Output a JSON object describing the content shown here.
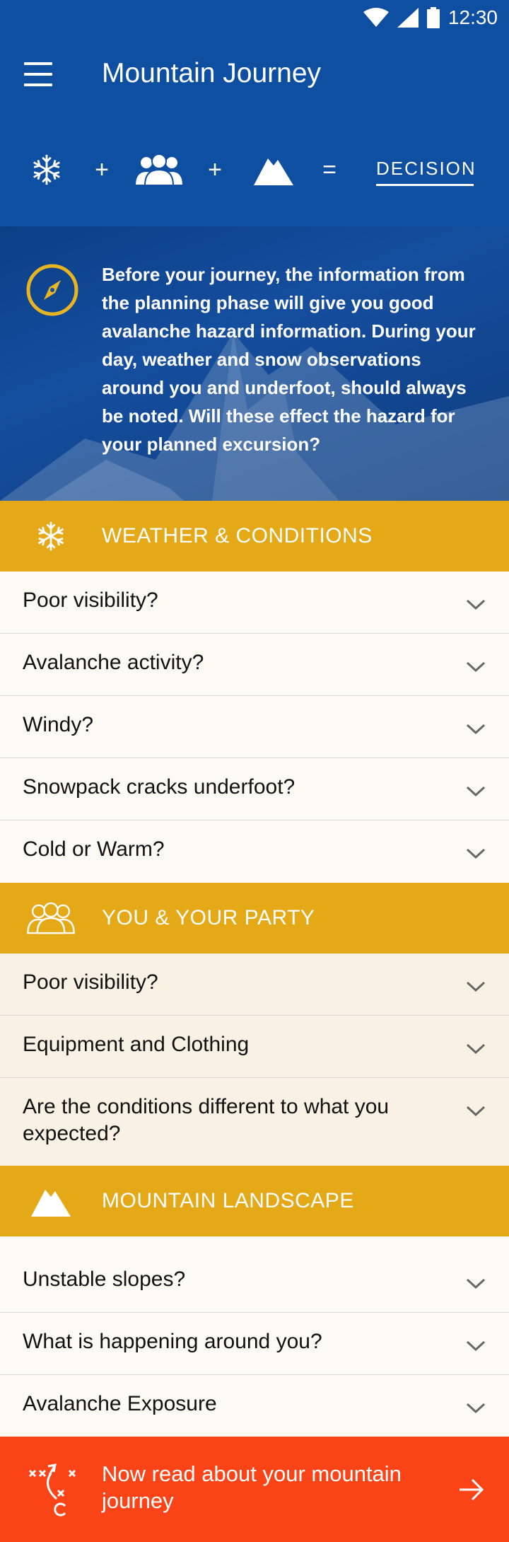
{
  "status_bar": {
    "time": "12:30"
  },
  "app_bar": {
    "title": "Mountain Journey",
    "menu_icon": "hamburger-menu-icon"
  },
  "equation": {
    "items": [
      "snowflake-icon",
      "+",
      "people-icon",
      "+",
      "mountain-icon",
      "="
    ],
    "decision_label": "DECISION"
  },
  "intro": {
    "icon": "compass-icon",
    "text": "Before your journey, the information from the planning phase will give you good avalanche hazard information. During your day, weather and snow observations around you and underfoot, should always be noted. Will these effect the hazard for your planned excursion?"
  },
  "sections": [
    {
      "title": "WEATHER & CONDITIONS",
      "icon": "snowflake-icon",
      "items": [
        "Poor visibility?",
        "Avalanche activity?",
        "Windy?",
        "Snowpack cracks underfoot?",
        "Cold or Warm?"
      ]
    },
    {
      "title": "YOU & YOUR PARTY",
      "icon": "people-icon",
      "items": [
        "Poor visibility?",
        "Equipment and Clothing",
        "Are the conditions different to what you expected?"
      ]
    },
    {
      "title": "MOUNTAIN LANDSCAPE",
      "icon": "mountain-icon",
      "items": [
        "Unstable slopes?",
        "What is happening around you?",
        "Avalanche Exposure"
      ]
    }
  ],
  "cta": {
    "label": "Now read about your mountain journey",
    "icon": "strategy-play-icon",
    "arrow_icon": "arrow-right-icon"
  },
  "colors": {
    "primary_blue": "#0f4fa1",
    "section_gold": "#e5a917",
    "cta_orange": "#fa4316",
    "row_bg": "#fdfaf3"
  }
}
